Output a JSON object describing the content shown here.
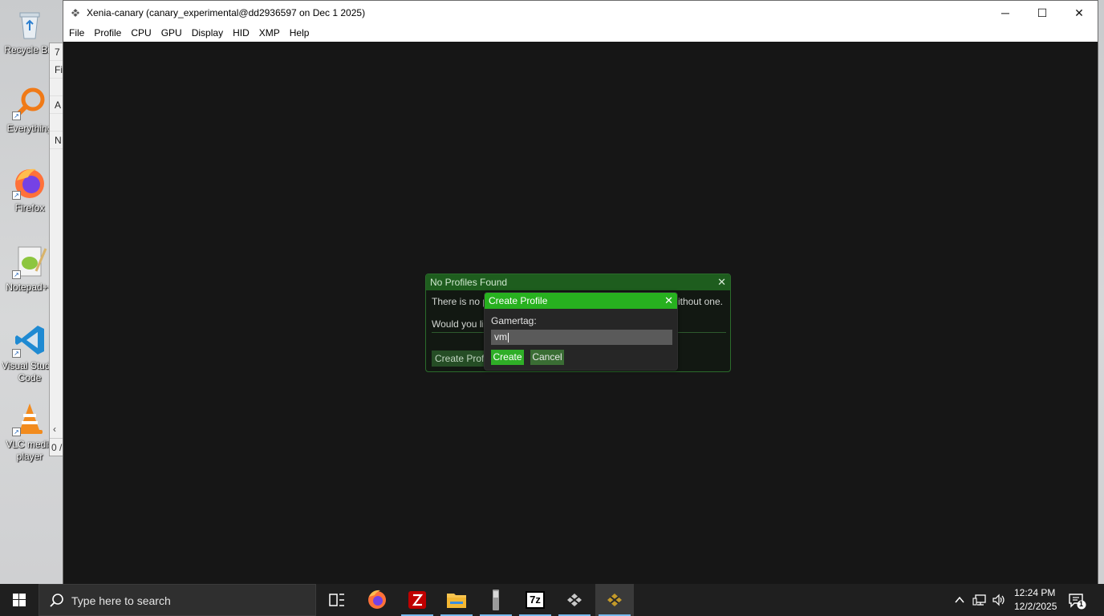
{
  "desktop": {
    "icons": [
      {
        "label": "Recycle Bin"
      },
      {
        "label": "Everything"
      },
      {
        "label": "Firefox"
      },
      {
        "label": "Notepad++"
      },
      {
        "label": "Visual Studio Code"
      },
      {
        "label": "VLC media player"
      }
    ],
    "background_window": {
      "rows": [
        "7",
        "Fi",
        "",
        "A",
        "",
        "N"
      ],
      "status": "0 /"
    }
  },
  "window": {
    "title": "Xenia-canary (canary_experimental@dd2936597 on Dec  1 2025)",
    "menu": [
      "File",
      "Profile",
      "CPU",
      "GPU",
      "Display",
      "HID",
      "XMP",
      "Help"
    ],
    "caption": {
      "minimize": "─",
      "maximize": "☐",
      "close": "✕"
    }
  },
  "no_profiles_dialog": {
    "title": "No Profiles Found",
    "close": "✕",
    "line1_start": "There is no p",
    "line1_end": "without one.",
    "line2_start": "Would you li",
    "button": "Create Profi"
  },
  "create_profile_dialog": {
    "title": "Create Profile",
    "close": "✕",
    "gamertag_label": "Gamertag:",
    "gamertag_value": "vm",
    "create_label": "Create",
    "cancel_label": "Cancel"
  },
  "taskbar": {
    "search_placeholder": "Type here to search",
    "apps": [
      "task-view",
      "firefox",
      "filezilla",
      "file-explorer",
      "usb-tool",
      "7-zip",
      "xenia",
      "xenia-canary"
    ],
    "clock_time": "12:24 PM",
    "clock_date": "12/2/2025",
    "notification_count": "1",
    "seven_zip_label": "7z"
  },
  "colors": {
    "imgui_header_active": "#27b11f",
    "imgui_header_inactive": "#1e5d1e",
    "viewport_bg": "#161616",
    "taskbar_bg": "#1f1f1f",
    "accent_underline": "#76b9ed"
  }
}
